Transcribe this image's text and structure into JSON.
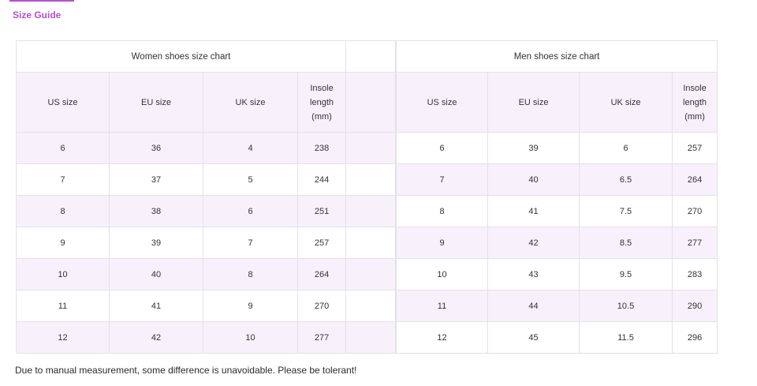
{
  "tab": {
    "label": "Size Guide"
  },
  "women": {
    "title": "Women shoes size chart",
    "headers": [
      "US size",
      "EU size",
      "UK size",
      "Insole length (mm)"
    ],
    "rows": [
      [
        "6",
        "36",
        "4",
        "238"
      ],
      [
        "7",
        "37",
        "5",
        "244"
      ],
      [
        "8",
        "38",
        "6",
        "251"
      ],
      [
        "9",
        "39",
        "7",
        "257"
      ],
      [
        "10",
        "40",
        "8",
        "264"
      ],
      [
        "11",
        "41",
        "9",
        "270"
      ],
      [
        "12",
        "42",
        "10",
        "277"
      ]
    ]
  },
  "men": {
    "title": "Men shoes size chart",
    "headers": [
      "US size",
      "EU size",
      "UK size",
      "Insole length (mm)"
    ],
    "rows": [
      [
        "6",
        "39",
        "6",
        "257"
      ],
      [
        "7",
        "40",
        "6.5",
        "264"
      ],
      [
        "8",
        "41",
        "7.5",
        "270"
      ],
      [
        "9",
        "42",
        "8.5",
        "277"
      ],
      [
        "10",
        "43",
        "9.5",
        "283"
      ],
      [
        "11",
        "44",
        "10.5",
        "290"
      ],
      [
        "12",
        "45",
        "11.5",
        "296"
      ]
    ]
  },
  "note": "Due to manual measurement, some difference is unavoidable. Please be tolerant!"
}
